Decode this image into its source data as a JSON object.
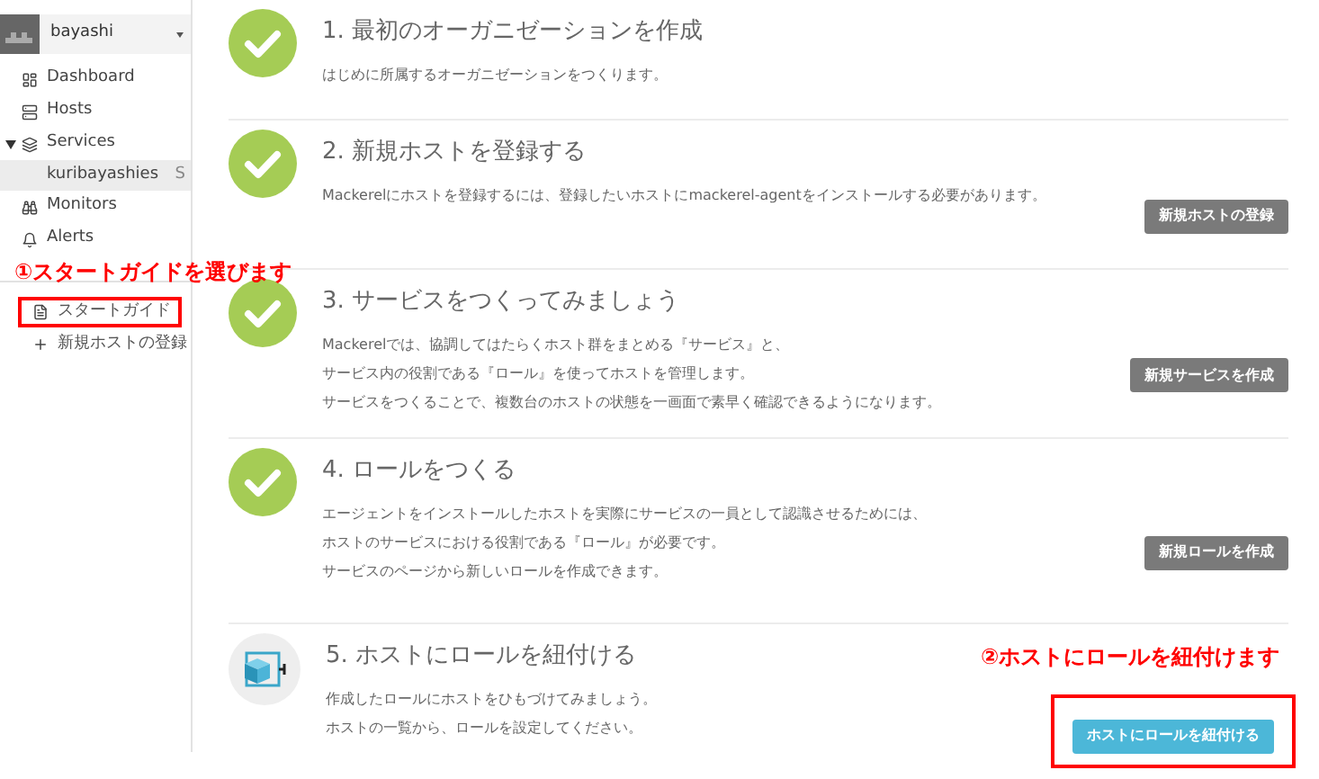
{
  "sidebar": {
    "org": {
      "name": "bayashi"
    },
    "nav": [
      {
        "kind": "dashboard",
        "label": "Dashboard"
      },
      {
        "kind": "hosts",
        "label": "Hosts"
      },
      {
        "kind": "services",
        "label": "Services",
        "expanded": true,
        "children": [
          {
            "label": "kuribayashies",
            "badge": "S",
            "selected": true
          }
        ]
      },
      {
        "kind": "monitors",
        "label": "Monitors"
      },
      {
        "kind": "alerts",
        "label": "Alerts"
      }
    ],
    "guide": [
      {
        "kind": "doc",
        "label": "スタートガイド",
        "highlighted": true
      },
      {
        "kind": "add",
        "label": "新規ホストの登録",
        "highlighted": false
      }
    ]
  },
  "steps": [
    {
      "done": true,
      "title": "1. 最初のオーガニゼーションを作成",
      "lines": [
        "はじめに所属するオーガニゼーションをつくります。"
      ]
    },
    {
      "done": true,
      "title": "2. 新規ホストを登録する",
      "lines": [
        "Mackerelにホストを登録するには、登録したいホストにmackerel-agentをインストールする必要があります。"
      ],
      "button": {
        "label": "新規ホストの登録",
        "kind": "default",
        "highlighted": false
      }
    },
    {
      "done": true,
      "title": "3. サービスをつくってみましょう",
      "lines": [
        "Mackerelでは、協調してはたらくホスト群をまとめる『サービス』と、",
        "サービス内の役割である『ロール』を使ってホストを管理します。",
        "サービスをつくることで、複数台のホストの状態を一画面で素早く確認できるようになります。"
      ],
      "button": {
        "label": "新規サービスを作成",
        "kind": "default",
        "highlighted": false
      }
    },
    {
      "done": true,
      "title": "4. ロールをつくる",
      "lines": [
        "エージェントをインストールしたホストを実際にサービスの一員として認識させるためには、",
        "ホストのサービスにおける役割である『ロール』が必要です。",
        "サービスのページから新しいロールを作成できます。"
      ],
      "button": {
        "label": "新規ロールを作成",
        "kind": "default",
        "highlighted": false
      }
    },
    {
      "done": false,
      "title": "5. ホストにロールを紐付ける",
      "lines": [
        "作成したロールにホストをひもづけてみましょう。",
        "ホストの一覧から、ロールを設定してください。"
      ],
      "button": {
        "label": "ホストにロールを紐付ける",
        "kind": "primary",
        "highlighted": true
      }
    }
  ],
  "annotations": [
    "①スタートガイドを選びます",
    "②ホストにロールを紐付けます"
  ]
}
